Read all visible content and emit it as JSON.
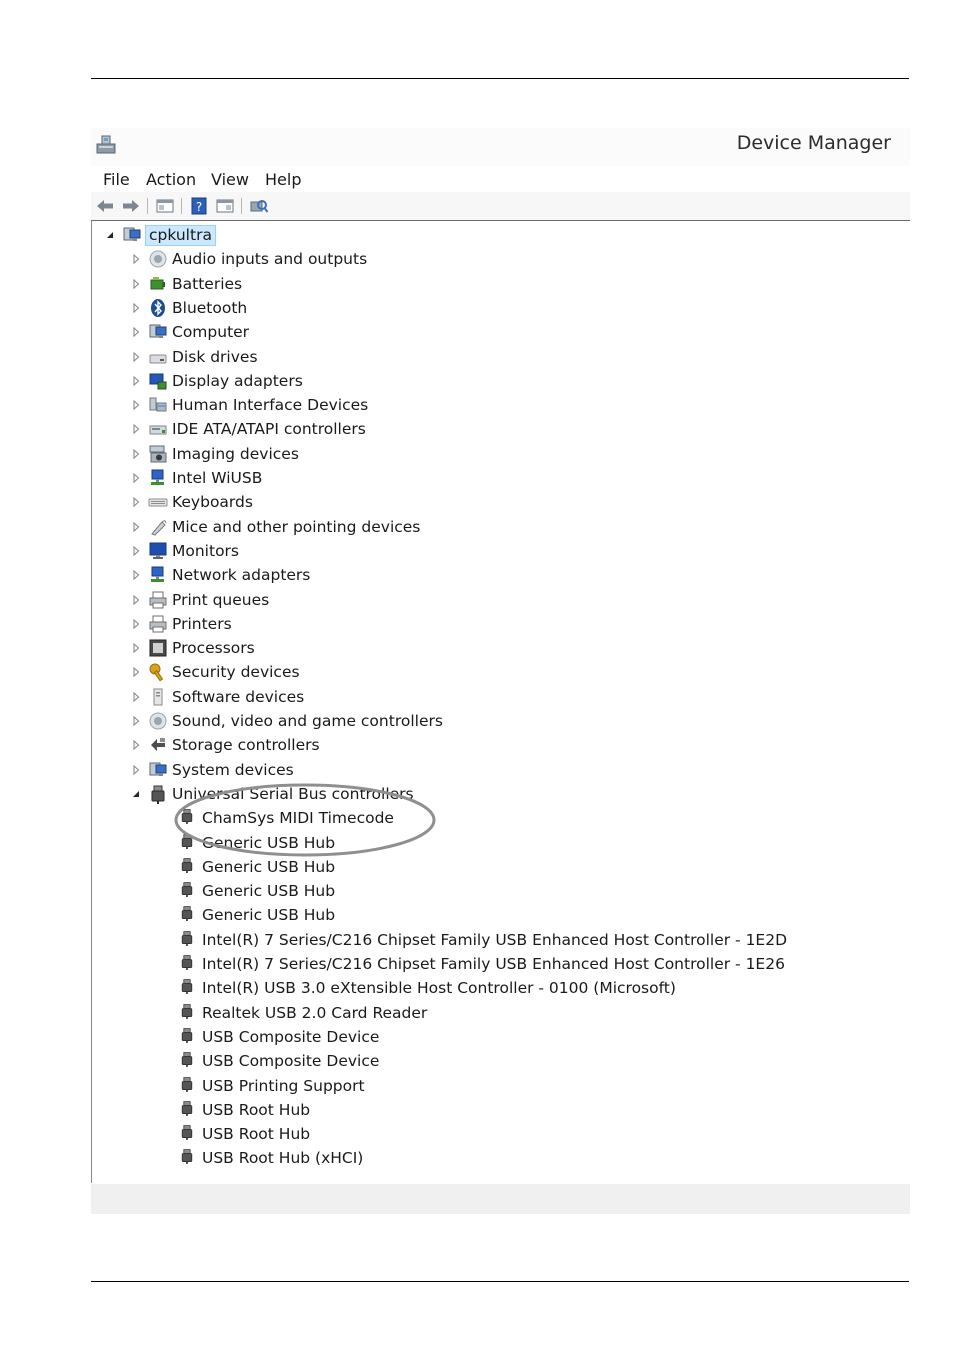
{
  "window": {
    "title": "Device Manager",
    "app_icon": "device-manager-icon"
  },
  "menu": [
    "File",
    "Action",
    "View",
    "Help"
  ],
  "toolbar": [
    {
      "name": "back-icon"
    },
    {
      "name": "forward-icon"
    },
    {
      "name": "show-hide-console-tree-icon"
    },
    {
      "name": "help-icon"
    },
    {
      "name": "properties-icon"
    },
    {
      "name": "scan-hardware-icon"
    }
  ],
  "tree": {
    "root": {
      "label": "cpkultra",
      "icon": "computer-icon",
      "expanded": true
    },
    "categories": [
      {
        "label": "Audio inputs and outputs",
        "icon": "speaker-icon",
        "color": "#9aa5ad"
      },
      {
        "label": "Batteries",
        "icon": "battery-icon",
        "color": "#3f8f2f"
      },
      {
        "label": "Bluetooth",
        "icon": "bluetooth-icon",
        "color": "#1c4e96"
      },
      {
        "label": "Computer",
        "icon": "computer-icon",
        "color": "#3a6fc4"
      },
      {
        "label": "Disk drives",
        "icon": "disk-drive-icon",
        "color": "#8c8c8c"
      },
      {
        "label": "Display adapters",
        "icon": "display-adapter-icon",
        "color": "#2457b8"
      },
      {
        "label": "Human Interface Devices",
        "icon": "hid-icon",
        "color": "#6d7a87"
      },
      {
        "label": "IDE ATA/ATAPI controllers",
        "icon": "ide-controller-icon",
        "color": "#7b8790"
      },
      {
        "label": "Imaging devices",
        "icon": "camera-icon",
        "color": "#606b75"
      },
      {
        "label": "Intel WiUSB",
        "icon": "network-icon",
        "color": "#2f63c6"
      },
      {
        "label": "Keyboards",
        "icon": "keyboard-icon",
        "color": "#8c8c8c"
      },
      {
        "label": "Mice and other pointing devices",
        "icon": "mouse-icon",
        "color": "#7a7a7a"
      },
      {
        "label": "Monitors",
        "icon": "monitor-icon",
        "color": "#1f4fae"
      },
      {
        "label": "Network adapters",
        "icon": "network-icon",
        "color": "#2f63c6"
      },
      {
        "label": "Print queues",
        "icon": "printer-icon",
        "color": "#6f6f6f"
      },
      {
        "label": "Printers",
        "icon": "printer-icon",
        "color": "#6f6f6f"
      },
      {
        "label": "Processors",
        "icon": "processor-icon",
        "color": "#4a4a4a"
      },
      {
        "label": "Security devices",
        "icon": "key-icon",
        "color": "#d7a21c"
      },
      {
        "label": "Software devices",
        "icon": "software-device-icon",
        "color": "#8a8a8a"
      },
      {
        "label": "Sound, video and game controllers",
        "icon": "speaker-icon",
        "color": "#9aa5ad"
      },
      {
        "label": "Storage controllers",
        "icon": "storage-controller-icon",
        "color": "#4e4e4e"
      },
      {
        "label": "System devices",
        "icon": "computer-icon",
        "color": "#3a6fc4"
      },
      {
        "label": "Universal Serial Bus controllers",
        "icon": "usb-plug-icon",
        "color": "#555555",
        "expanded": true
      }
    ],
    "usb_children": [
      "ChamSys MIDI Timecode",
      "Generic USB Hub",
      "Generic USB Hub",
      "Generic USB Hub",
      "Generic USB Hub",
      "Intel(R) 7 Series/C216 Chipset Family USB Enhanced Host Controller - 1E2D",
      "Intel(R) 7 Series/C216 Chipset Family USB Enhanced Host Controller - 1E26",
      "Intel(R) USB 3.0 eXtensible Host Controller - 0100 (Microsoft)",
      "Realtek USB 2.0 Card Reader",
      "USB Composite Device",
      "USB Composite Device",
      "USB Printing Support",
      "USB Root Hub",
      "USB Root Hub",
      "USB Root Hub (xHCI)"
    ]
  }
}
